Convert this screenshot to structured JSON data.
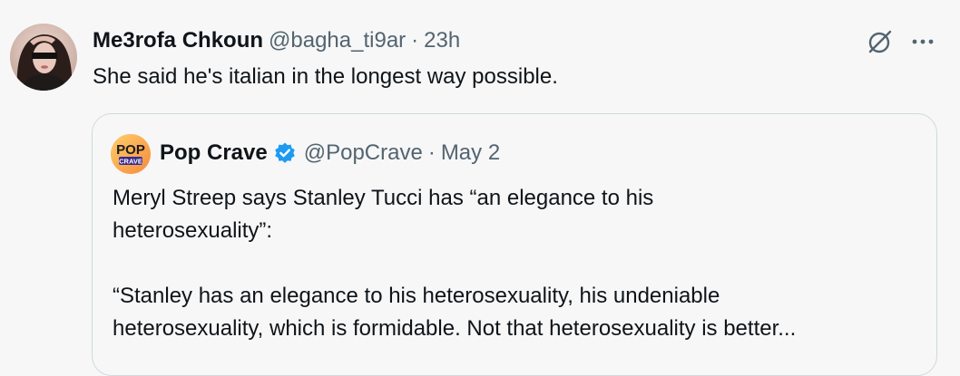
{
  "tweet": {
    "author_name": "Me3rofa Chkoun",
    "author_handle": "@bagha_ti9ar",
    "separator": "·",
    "timestamp": "23h",
    "text": "She said he's italian in the longest way possible."
  },
  "actions": {
    "grok_icon": "grok-icon",
    "more_icon": "more-icon"
  },
  "quote": {
    "avatar_text_top": "POP",
    "avatar_text_bottom": "CRAVE",
    "author_name": "Pop Crave",
    "author_handle": "@PopCrave",
    "separator": "·",
    "timestamp": "May 2",
    "verified": true,
    "lines": [
      "Meryl Streep says Stanley Tucci has “an elegance to his",
      "heterosexuality”:",
      "“Stanley has an elegance to his heterosexuality, his undeniable",
      "heterosexuality, which is formidable. Not that heterosexuality is better..."
    ]
  },
  "colors": {
    "background": "#f7f7f7",
    "primary_text": "#0f1419",
    "secondary_text": "#536471",
    "verified_blue": "#1d9bf0",
    "border": "#cfd9de"
  }
}
